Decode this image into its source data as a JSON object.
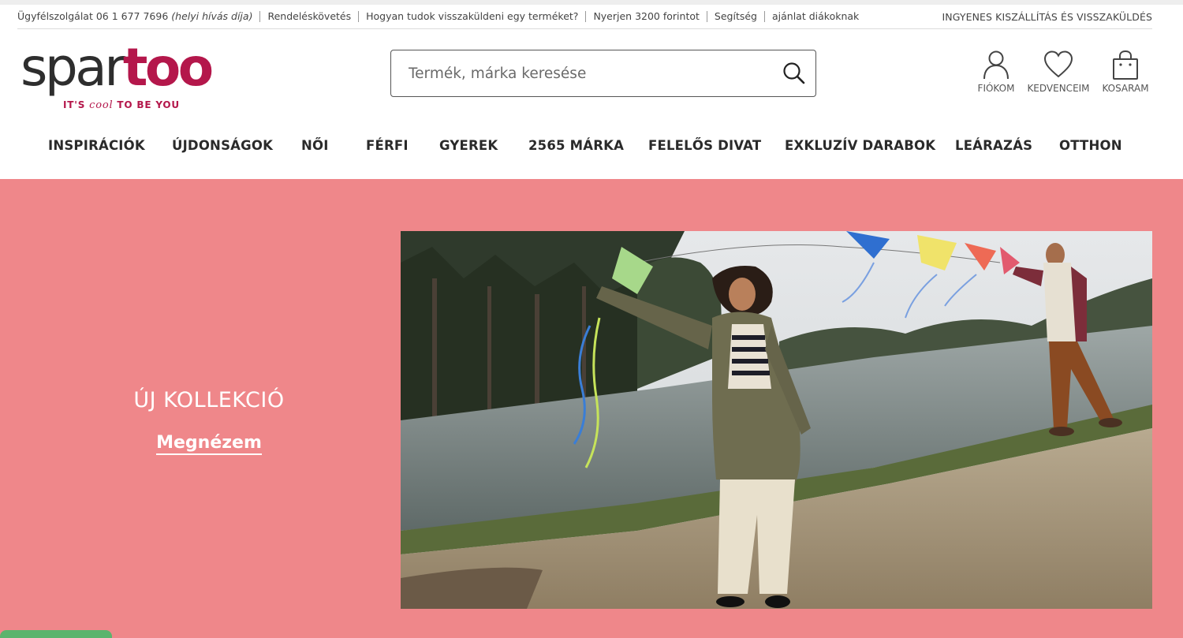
{
  "topbar": {
    "support_label": "Ügyfélszolgálat 06 1 677 7696",
    "support_note": "(helyi hívás díja)",
    "links": [
      "Rendeléskövetés",
      "Hogyan tudok visszaküldeni egy terméket?",
      "Nyerjen 3200 forintot",
      "Segítség",
      "ajánlat diákoknak"
    ],
    "shipping": "INGYENES KISZÁLLÍTÁS ÉS VISSZAKÜLDÉS"
  },
  "logo": {
    "spar": "spar",
    "too": "too",
    "tag_before": "IT'S ",
    "tag_cool": "cool",
    "tag_after": " TO BE YOU"
  },
  "search": {
    "placeholder": "Termék, márka keresése",
    "value": ""
  },
  "account": {
    "fiokom": "FIÓKOM",
    "kedvenceim": "KEDVENCEIM",
    "kosaram": "KOSARAM"
  },
  "nav": {
    "items": [
      "INSPIRÁCIÓK",
      "ÚJDONSÁGOK",
      "NŐI",
      "FÉRFI",
      "GYEREK",
      "2565 MÁRKA",
      "FELELŐS DIVAT",
      "EXKLUZÍV DARABOK",
      "LEÁRAZÁS",
      "OTTHON"
    ]
  },
  "hero": {
    "title": "ÚJ KOLLEKCIÓ",
    "cta": "Megnézem",
    "background": "#ef878a"
  },
  "colors": {
    "brand": "#b4174b",
    "hero_bg": "#ef878a",
    "chat": "#5bb46d"
  }
}
